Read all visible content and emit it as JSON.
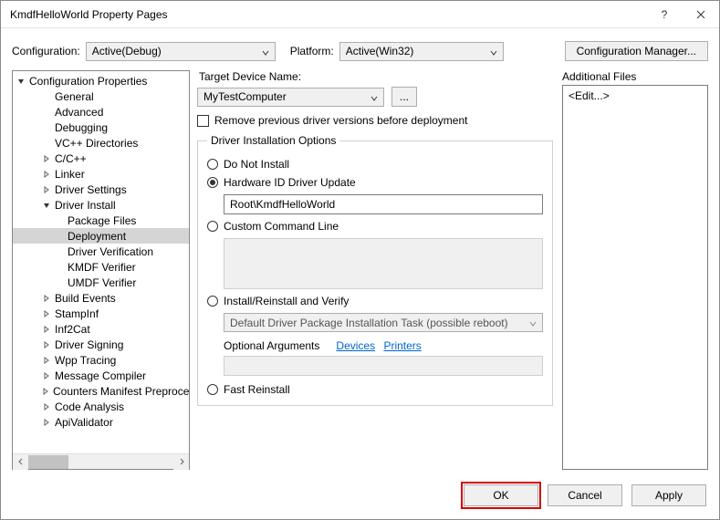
{
  "title": "KmdfHelloWorld Property Pages",
  "toolbar": {
    "config_label": "Configuration:",
    "config_value": "Active(Debug)",
    "platform_label": "Platform:",
    "platform_value": "Active(Win32)",
    "manager_label": "Configuration Manager..."
  },
  "tree": {
    "root": "Configuration Properties",
    "items": [
      {
        "label": "General",
        "depth": 2,
        "arrow": ""
      },
      {
        "label": "Advanced",
        "depth": 2,
        "arrow": ""
      },
      {
        "label": "Debugging",
        "depth": 2,
        "arrow": ""
      },
      {
        "label": "VC++ Directories",
        "depth": 2,
        "arrow": ""
      },
      {
        "label": "C/C++",
        "depth": 2,
        "arrow": "r"
      },
      {
        "label": "Linker",
        "depth": 2,
        "arrow": "r"
      },
      {
        "label": "Driver Settings",
        "depth": 2,
        "arrow": "r"
      },
      {
        "label": "Driver Install",
        "depth": 2,
        "arrow": "d"
      },
      {
        "label": "Package Files",
        "depth": 3,
        "arrow": ""
      },
      {
        "label": "Deployment",
        "depth": 3,
        "arrow": "",
        "selected": true
      },
      {
        "label": "Driver Verification",
        "depth": 3,
        "arrow": ""
      },
      {
        "label": "KMDF Verifier",
        "depth": 3,
        "arrow": ""
      },
      {
        "label": "UMDF Verifier",
        "depth": 3,
        "arrow": ""
      },
      {
        "label": "Build Events",
        "depth": 2,
        "arrow": "r"
      },
      {
        "label": "StampInf",
        "depth": 2,
        "arrow": "r"
      },
      {
        "label": "Inf2Cat",
        "depth": 2,
        "arrow": "r"
      },
      {
        "label": "Driver Signing",
        "depth": 2,
        "arrow": "r"
      },
      {
        "label": "Wpp Tracing",
        "depth": 2,
        "arrow": "r"
      },
      {
        "label": "Message Compiler",
        "depth": 2,
        "arrow": "r"
      },
      {
        "label": "Counters Manifest Preprocess",
        "depth": 2,
        "arrow": "r"
      },
      {
        "label": "Code Analysis",
        "depth": 2,
        "arrow": "r"
      },
      {
        "label": "ApiValidator",
        "depth": 2,
        "arrow": "r"
      }
    ]
  },
  "main": {
    "target_label": "Target Device Name:",
    "target_value": "MyTestComputer",
    "browse_label": "...",
    "remove_label": "Remove previous driver versions before deployment",
    "group_label": "Driver Installation Options",
    "opt_do_not": "Do Not Install",
    "opt_hw": "Hardware ID Driver Update",
    "hw_value": "Root\\KmdfHelloWorld",
    "opt_custom": "Custom Command Line",
    "opt_install": "Install/Reinstall and Verify",
    "install_task": "Default Driver Package Installation Task (possible reboot)",
    "optional_args": "Optional Arguments",
    "link_devices": "Devices",
    "link_printers": "Printers",
    "opt_fast": "Fast Reinstall"
  },
  "side": {
    "label": "Additional Files",
    "value": "<Edit...>"
  },
  "footer": {
    "ok": "OK",
    "cancel": "Cancel",
    "apply": "Apply"
  }
}
